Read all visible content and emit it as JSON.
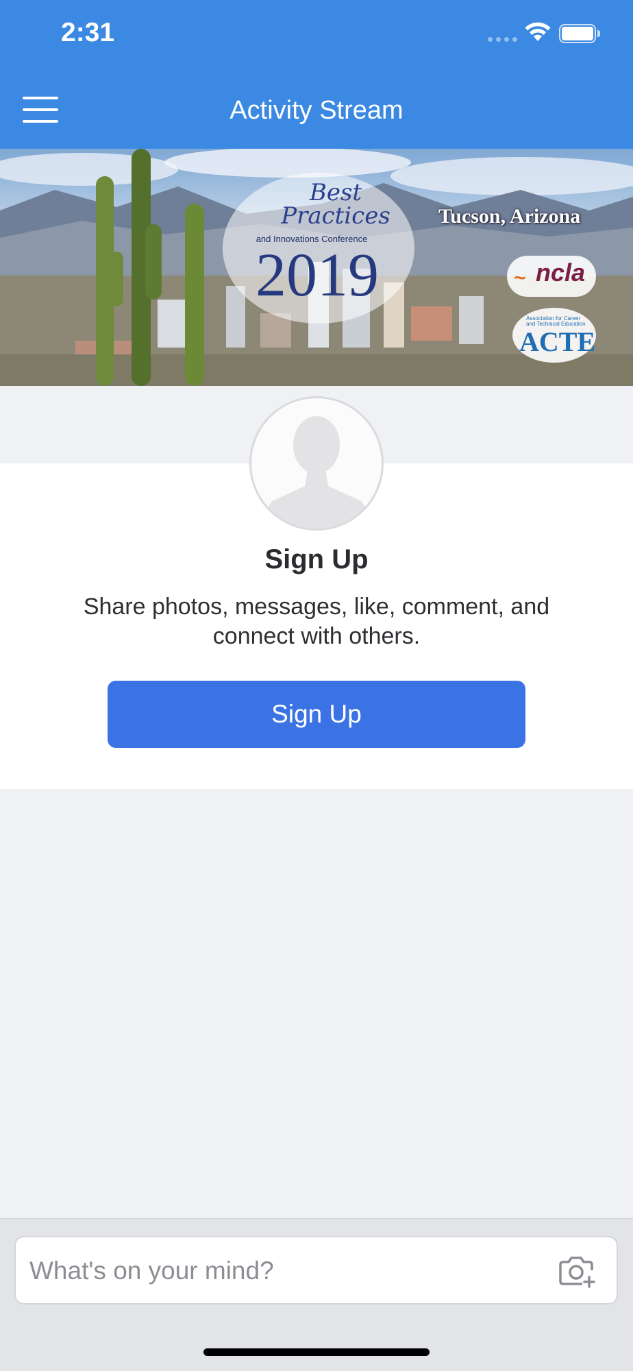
{
  "status_bar": {
    "time": "2:31"
  },
  "nav": {
    "title": "Activity Stream",
    "menu_icon": "hamburger-menu-icon"
  },
  "banner": {
    "best_practices": "Best Practices",
    "subtitle": "and Innovations Conference",
    "year": "2019",
    "location": "Tucson, Arizona",
    "ncla_logo": "ncla",
    "acte_tagline": "Association for Career and Technical Education",
    "acte_logo": "ACTE"
  },
  "profile": {
    "heading": "Sign Up",
    "description": "Share photos, messages, like, comment, and connect with others.",
    "button_label": "Sign Up"
  },
  "composer": {
    "placeholder": "What's on your mind?",
    "camera_icon": "add-photo-camera-icon"
  },
  "colors": {
    "header_blue": "#3b89e2",
    "button_blue": "#3c73e4",
    "page_background": "#eff1f5"
  }
}
